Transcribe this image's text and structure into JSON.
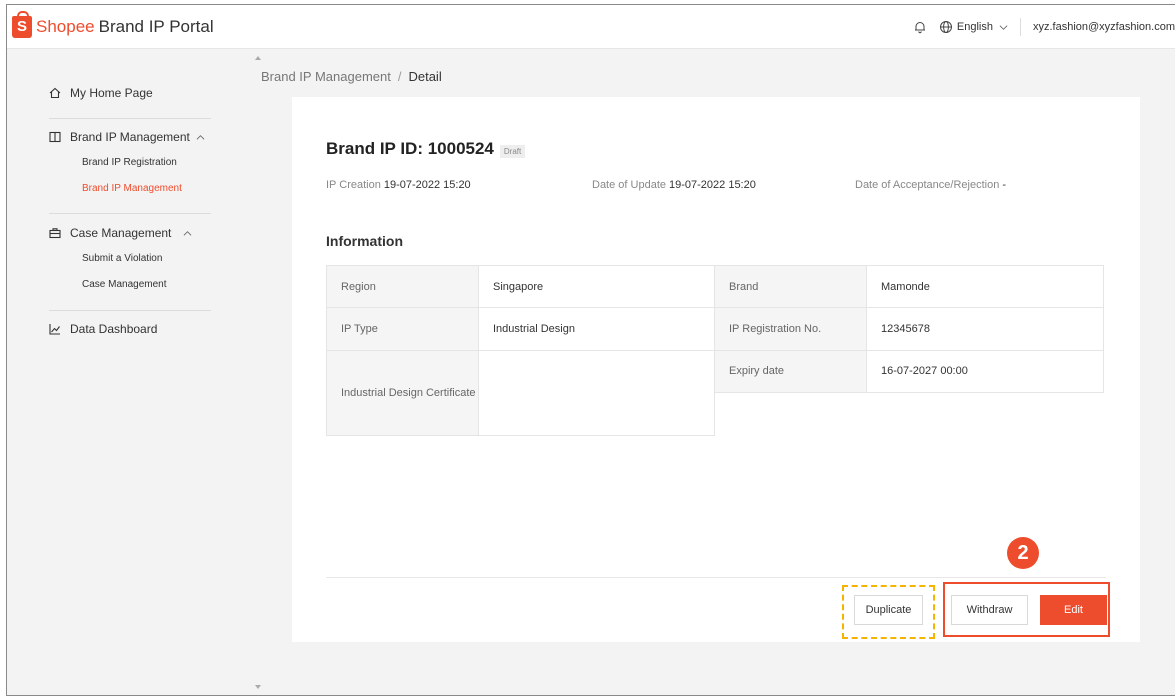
{
  "header": {
    "logo_brand": "Shopee",
    "logo_text": "Brand IP Portal",
    "language": "English",
    "user_email": "xyz.fashion@xyzfashion.com"
  },
  "sidebar": {
    "home": "My Home Page",
    "brand_ip_management": "Brand IP Management",
    "brand_ip_sub": [
      "Brand IP Registration",
      "Brand IP Management"
    ],
    "case_management": "Case Management",
    "case_sub": [
      "Submit a Violation",
      "Case Management"
    ],
    "data_dashboard": "Data Dashboard"
  },
  "breadcrumb": {
    "parent": "Brand IP Management",
    "separator": "/",
    "current": "Detail"
  },
  "detail": {
    "title": "Brand IP ID: 1000524",
    "status": "Draft",
    "ip_creation_label": "IP Creation",
    "ip_creation_value": "19-07-2022 15:20",
    "date_update_label": "Date of Update",
    "date_update_value": "19-07-2022 15:20",
    "date_accept_label": "Date of Acceptance/Rejection",
    "date_accept_value": "-",
    "section_title": "Information"
  },
  "info": {
    "region_label": "Region",
    "region_value": "Singapore",
    "brand_label": "Brand",
    "brand_value": "Mamonde",
    "ip_type_label": "IP Type",
    "ip_type_value": "Industrial Design",
    "ip_reg_label": "IP Registration No.",
    "ip_reg_value": "12345678",
    "certificate_label": "Industrial Design Certificate",
    "certificate_value": "",
    "expiry_label": "Expiry date",
    "expiry_value": "16-07-2027 00:00"
  },
  "actions": {
    "duplicate": "Duplicate",
    "withdraw": "Withdraw",
    "edit": "Edit",
    "step_number": "2"
  },
  "colors": {
    "brand": "#ee4d2d",
    "highlight_dashed": "#f5b400"
  }
}
